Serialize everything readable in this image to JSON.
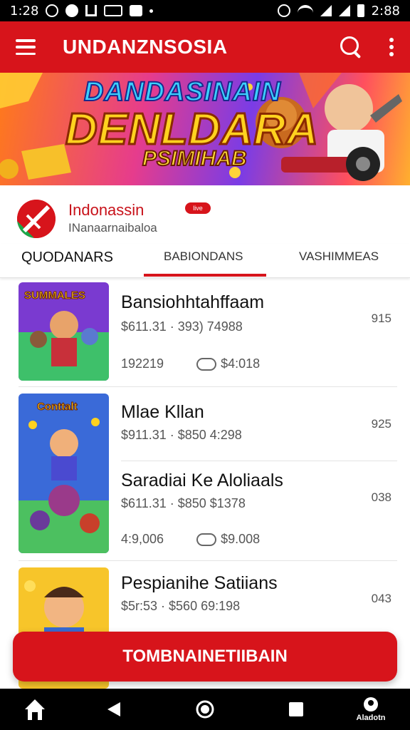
{
  "status_bar": {
    "time_left": "1:28",
    "time_right": "2:88"
  },
  "app_bar": {
    "title": "UNDANZNSOSIA"
  },
  "banner": {
    "line1": "DANDASINAIN",
    "line2": "DENLDARA",
    "line3": "PSIMIHAB"
  },
  "channel": {
    "name": "Indonassin",
    "badge": "live",
    "subtitle": "INanaarnaibaloa"
  },
  "tabs": [
    {
      "label": "QUODANARS"
    },
    {
      "label": "BABIONDANS"
    },
    {
      "label": "VASHIMMEAS"
    }
  ],
  "items": [
    {
      "title": "Bansiohhtahffaam",
      "meta": "$611.31 · 393) 74988",
      "count": "915",
      "stat_a": "192219",
      "stat_b": "$4:018"
    },
    {
      "title": "Mlae Kllan",
      "meta": "$911.31 · $850 4:298",
      "count": "925"
    },
    {
      "title": "Saradiai Ke Aloliaals",
      "meta": "$611.31 · $850 $1378",
      "count": "038",
      "stat_a": "4:9,006",
      "stat_b": "$9.008"
    },
    {
      "title": "Pespianihe Satiians",
      "meta": "$5r:53 · $560 69:198",
      "count": "043"
    }
  ],
  "thumb_labels": {
    "t1": "SUMMALES",
    "t2": "Conttalt"
  },
  "cta": {
    "label": "TOMBNAINETIIBAIN"
  },
  "nav": {
    "profile_label": "Aladotn"
  },
  "colors": {
    "accent": "#d7141b",
    "status_bar": "#000000",
    "nav_bar": "#000000"
  }
}
